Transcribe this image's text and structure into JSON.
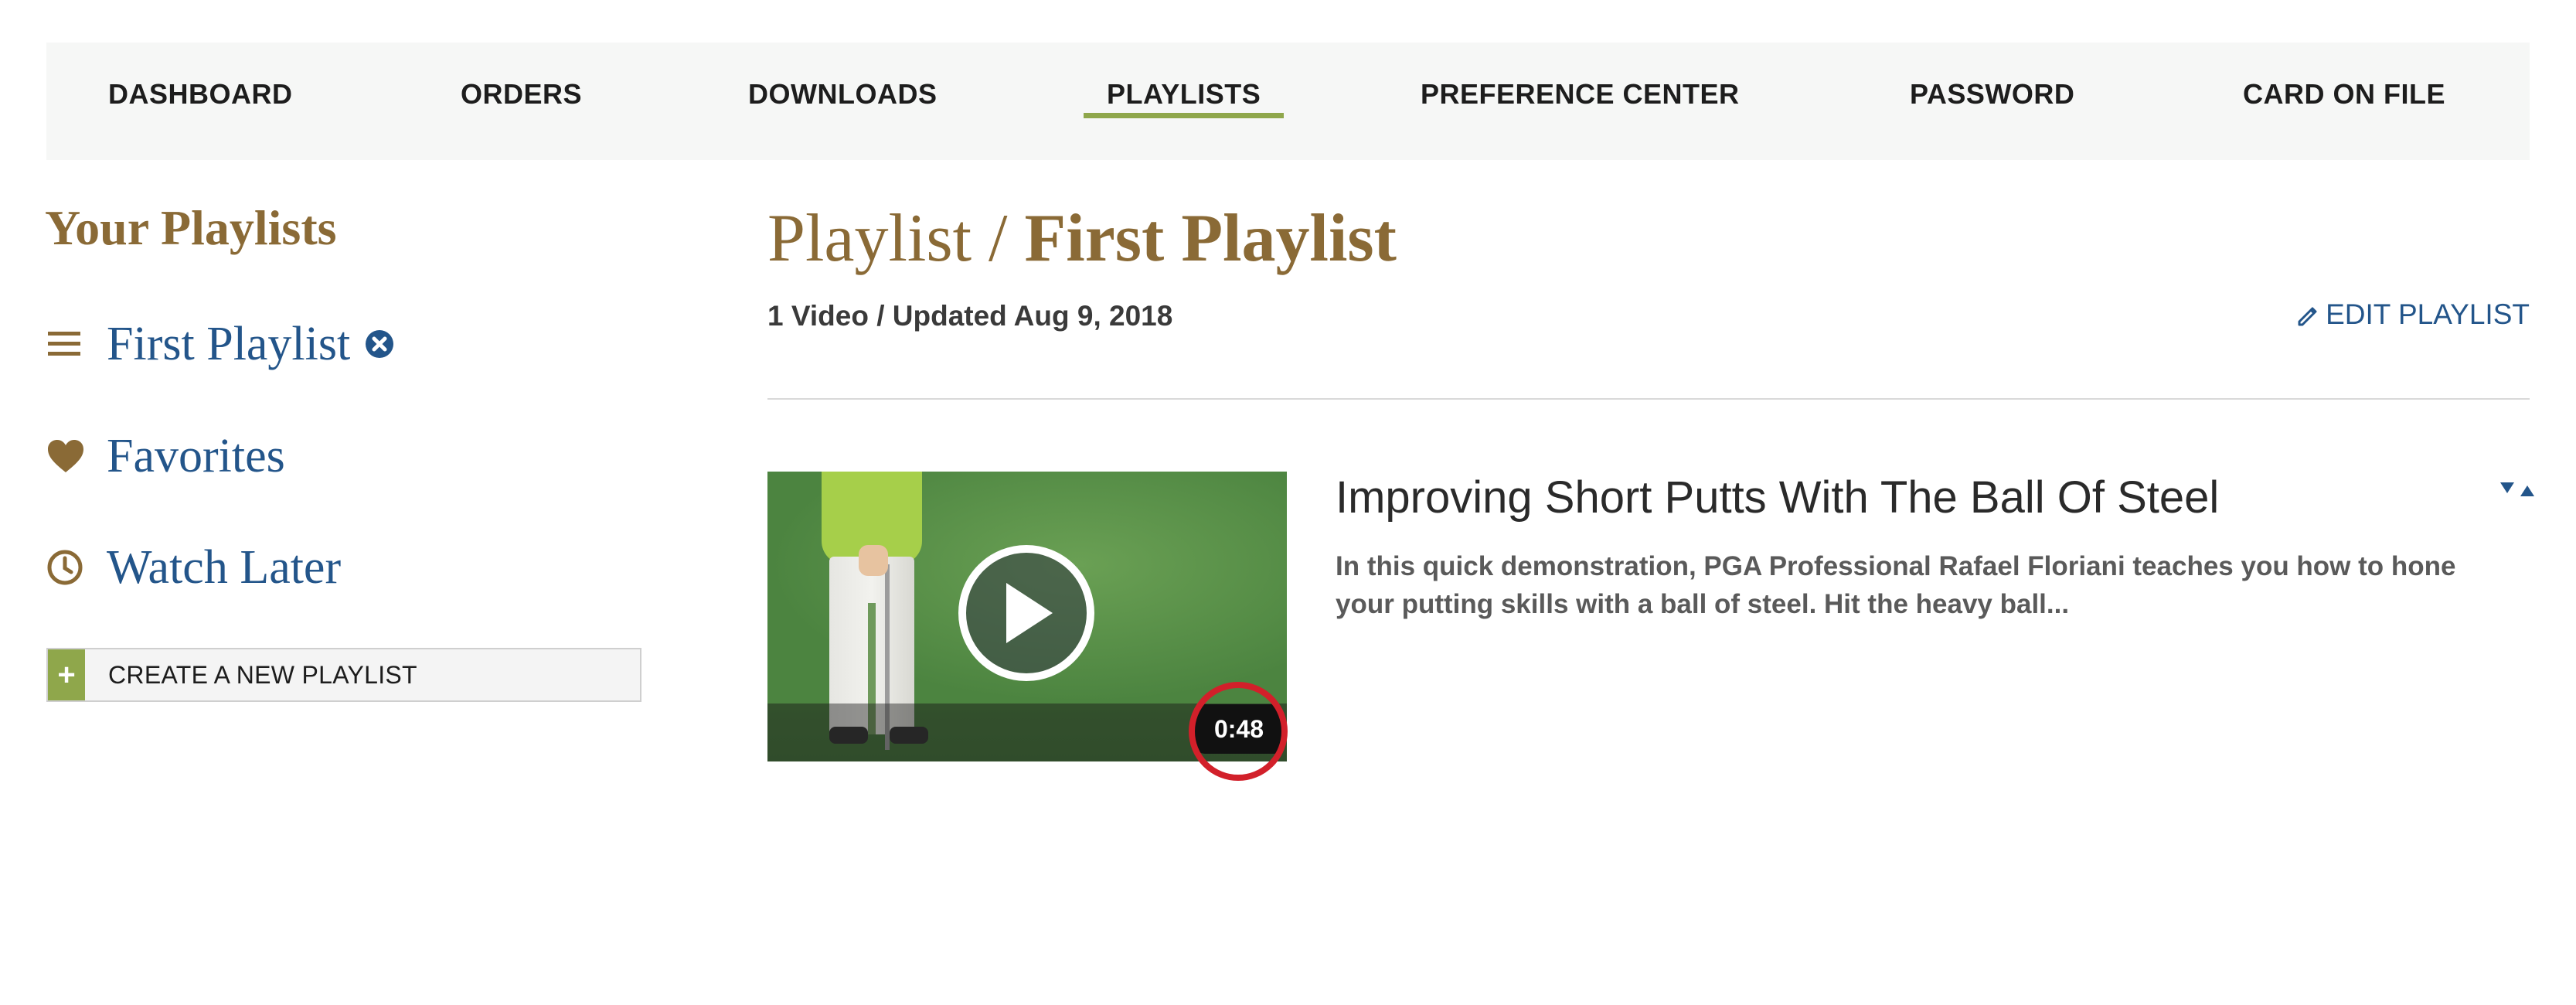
{
  "nav": {
    "items": [
      {
        "label": "DASHBOARD"
      },
      {
        "label": "ORDERS"
      },
      {
        "label": "DOWNLOADS"
      },
      {
        "label": "PLAYLISTS",
        "active": true
      },
      {
        "label": "PREFERENCE CENTER"
      },
      {
        "label": "PASSWORD"
      },
      {
        "label": "CARD ON FILE"
      }
    ],
    "active_color": "#8fa74b"
  },
  "sidebar": {
    "title": "Your Playlists",
    "items": [
      {
        "label": "First Playlist",
        "icon": "list-icon"
      },
      {
        "label": "Favorites",
        "icon": "heart-icon"
      },
      {
        "label": "Watch Later",
        "icon": "clock-icon"
      }
    ],
    "create_button": {
      "icon": "plus-icon",
      "label": "CREATE A NEW PLAYLIST"
    }
  },
  "main": {
    "heading_prefix": "Playlist /",
    "heading_name": "First Playlist",
    "meta": "1 Video / Updated Aug 9, 2018",
    "edit_label": "EDIT PLAYLIST",
    "videos": [
      {
        "title": "Improving Short Putts With The Ball Of Steel",
        "description": "In this quick demonstration, PGA Professional Rafael Floriani teaches you how to hone your putting skills with a ball of steel. Hit the heavy ball...",
        "duration": "0:48"
      }
    ]
  },
  "colors": {
    "brand_gold": "#8a6a36",
    "link_blue": "#23558a",
    "accent_green": "#8fa74b",
    "highlight_red": "#d2202a"
  }
}
